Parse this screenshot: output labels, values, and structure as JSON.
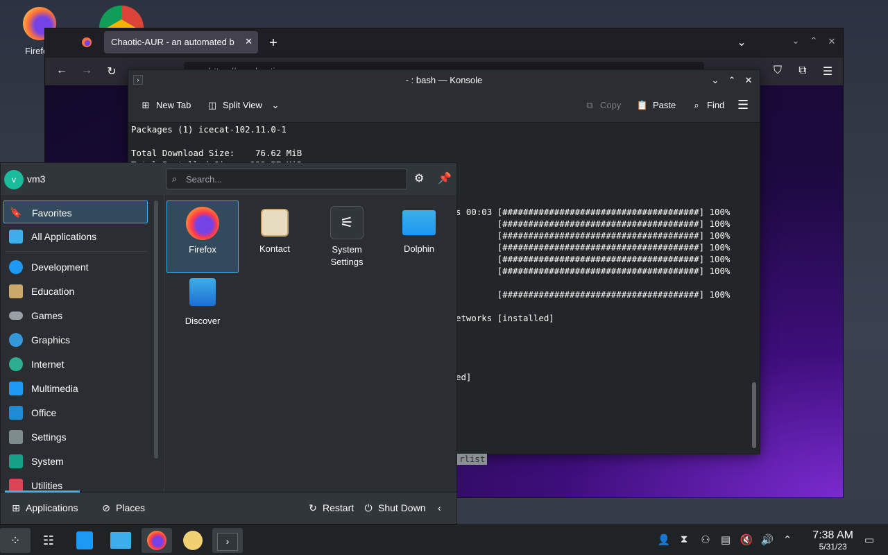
{
  "desktop": {
    "icons": [
      {
        "label": "Firefo",
        "icon": "firefox-icon"
      },
      {
        "label": "",
        "icon": "chrome-icon"
      }
    ]
  },
  "browser": {
    "tab_title": "Chaotic-AUR - an automated b",
    "new_tab": "+",
    "url_partial": "https://aur.chaotic"
  },
  "konsole": {
    "title": "- : bash — Konsole",
    "toolbar": {
      "new_tab": "New Tab",
      "split_view": "Split View",
      "copy": "Copy",
      "paste": "Paste",
      "find": "Find"
    },
    "lines": [
      "Packages (1) icecat-102.11.0-1",
      "",
      "Total Download Size:    76.62 MiB",
      "Total Installed Size:  233.77 MiB"
    ],
    "right_lines": [
      "s 00:03 [######################################] 100%",
      "        [######################################] 100%",
      "        [######################################] 100%",
      "        [######################################] 100%",
      "        [######################################] 100%",
      "        [######################################] 100%",
      "",
      "        [######################################] 100%",
      "",
      "etworks [installed]",
      "",
      "",
      "",
      "",
      "ed]"
    ],
    "behind_fragment": "rlist"
  },
  "launcher": {
    "user": "vm3",
    "avatar_letter": "v",
    "search_placeholder": "Search...",
    "categories": [
      {
        "label": "Favorites",
        "icon": "star-icon",
        "color": "#2a2e32"
      },
      {
        "label": "All Applications",
        "icon": "grid-icon",
        "color": "#3daee9"
      },
      {
        "label": "Development",
        "icon": "development-icon",
        "color": "#1d99f3"
      },
      {
        "label": "Education",
        "icon": "education-icon",
        "color": "#c9a86a"
      },
      {
        "label": "Games",
        "icon": "gamepad-icon",
        "color": "#9aa0a6"
      },
      {
        "label": "Graphics",
        "icon": "graphics-icon",
        "color": "#3498db"
      },
      {
        "label": "Internet",
        "icon": "globe-icon",
        "color": "#2eae91"
      },
      {
        "label": "Multimedia",
        "icon": "multimedia-icon",
        "color": "#1d99f3"
      },
      {
        "label": "Office",
        "icon": "office-icon",
        "color": "#1e8bd4"
      },
      {
        "label": "Settings",
        "icon": "settings-icon",
        "color": "#7f8c8d"
      },
      {
        "label": "System",
        "icon": "system-icon",
        "color": "#16a085"
      },
      {
        "label": "Utilities",
        "icon": "utilities-icon",
        "color": "#da4453"
      }
    ],
    "apps": [
      {
        "label": "Firefox",
        "icon": "firefox-icon",
        "color": "#ff7139"
      },
      {
        "label": "Kontact",
        "icon": "kontact-icon",
        "color": "#d9c08a"
      },
      {
        "label": "System\nSettings",
        "icon": "system-settings-icon",
        "color": "#31363b"
      },
      {
        "label": "Dolphin",
        "icon": "dolphin-icon",
        "color": "#3daee9"
      },
      {
        "label": "Discover",
        "icon": "discover-icon",
        "color": "#1d99f3"
      }
    ],
    "footer": {
      "applications": "Applications",
      "places": "Places",
      "restart": "Restart",
      "shutdown": "Shut Down"
    }
  },
  "taskbar": {
    "time": "7:38 AM",
    "date": "5/31/23",
    "items": [
      "app-launcher-icon",
      "system-settings-icon",
      "discover-icon",
      "dolphin-icon",
      "firefox-icon",
      "amarok-icon",
      "konsole-icon"
    ]
  }
}
